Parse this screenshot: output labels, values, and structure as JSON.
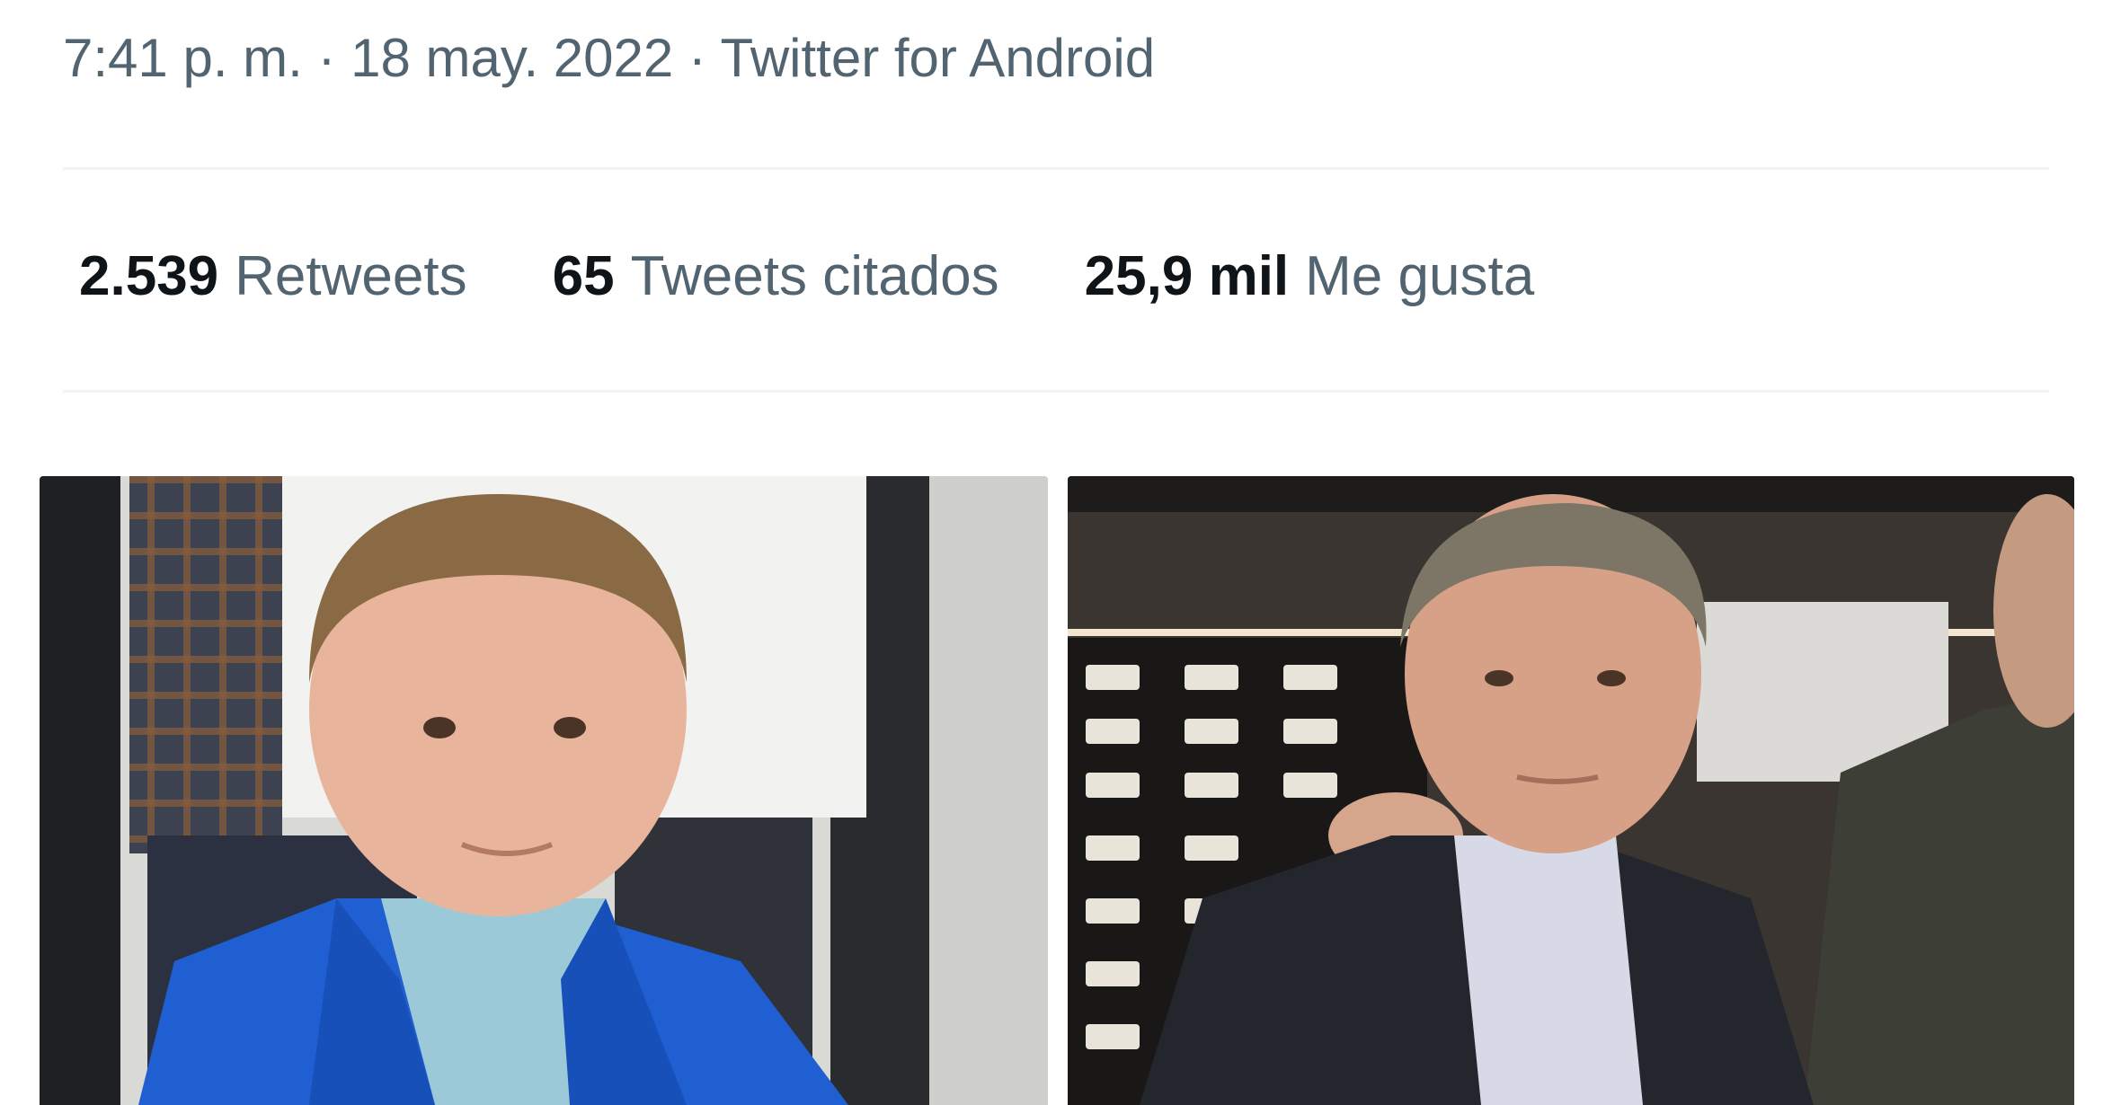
{
  "tweet": {
    "time": "7:41 p. m.",
    "sep1": " · ",
    "date": "18 may. 2022",
    "sep2": " · ",
    "source": "Twitter for Android"
  },
  "stats": {
    "retweets_count": "2.539",
    "retweets_label": "Retweets",
    "quotes_count": "65",
    "quotes_label": "Tweets citados",
    "likes_count": "25,9 mil",
    "likes_label": "Me gusta"
  },
  "media": {
    "photo1": "photo-young-man-blue-suit",
    "photo2": "photo-older-man-dark-jacket"
  },
  "colors": {
    "secondary_text": "#536471",
    "primary_text": "#0f1419",
    "divider": "#eff3f4"
  }
}
